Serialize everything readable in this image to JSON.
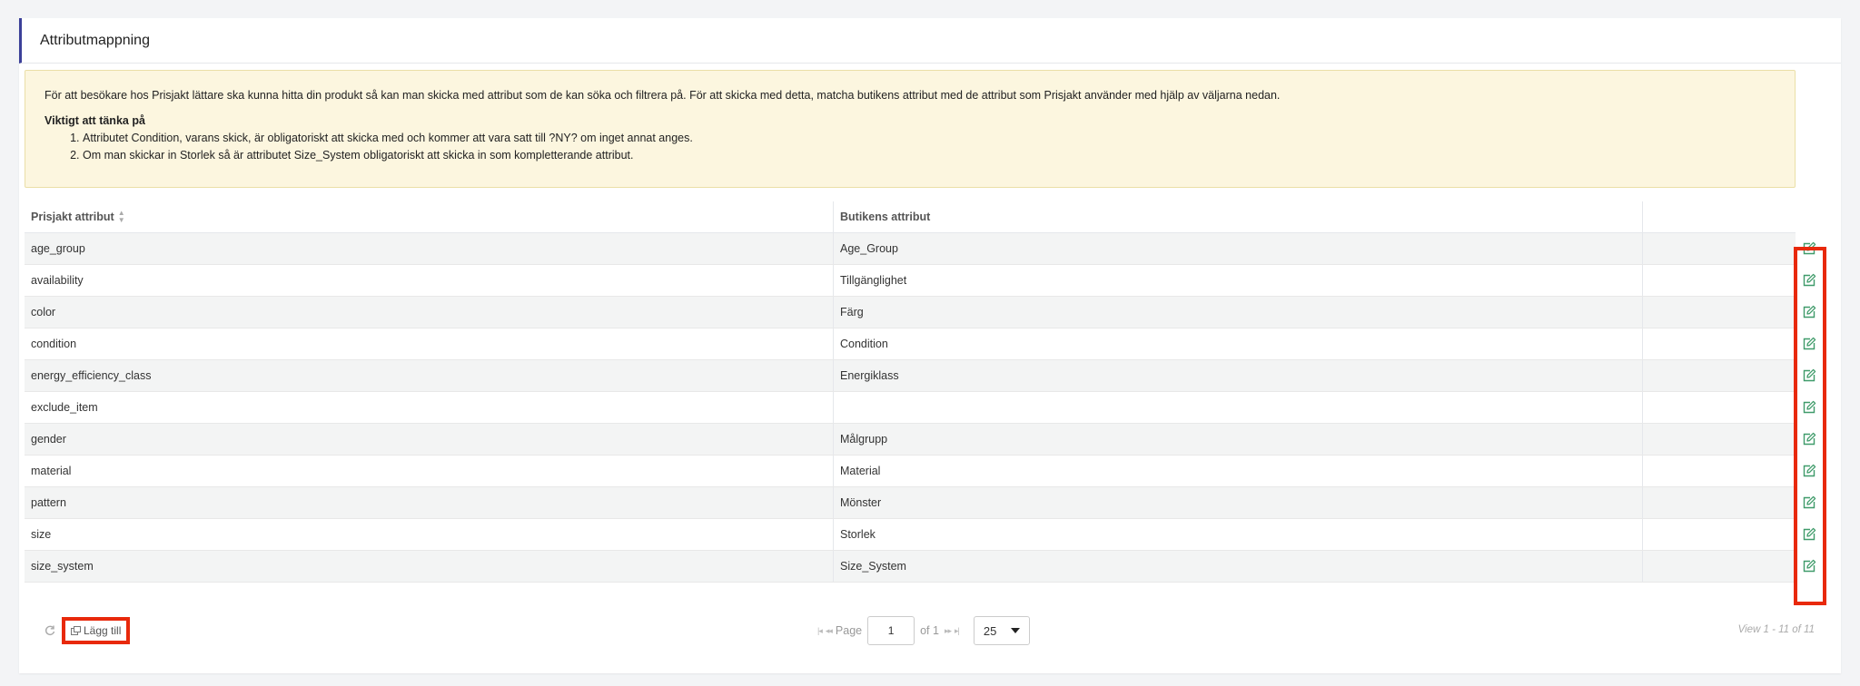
{
  "panel": {
    "title": "Attributmappning"
  },
  "notice": {
    "intro": "För att besökare hos Prisjakt lättare ska kunna hitta din produkt så kan man skicka med attribut som de kan söka och filtrera på. För att skicka med detta, matcha butikens attribut med de attribut som Prisjakt använder med hjälp av väljarna nedan.",
    "heading": "Viktigt att tänka på",
    "items": [
      "Attributet Condition, varans skick, är obligatoriskt att skicka med och kommer att vara satt till ?NY? om inget annat anges.",
      "Om man skickar in Storlek så är attributet Size_System obligatoriskt att skicka in som kompletterande attribut."
    ]
  },
  "grid": {
    "headers": {
      "prisjakt": "Prisjakt attribut",
      "butik": "Butikens attribut"
    },
    "rows": [
      {
        "prisjakt": "age_group",
        "butik": "Age_Group"
      },
      {
        "prisjakt": "availability",
        "butik": "Tillgänglighet"
      },
      {
        "prisjakt": "color",
        "butik": "Färg"
      },
      {
        "prisjakt": "condition",
        "butik": "Condition"
      },
      {
        "prisjakt": "energy_efficiency_class",
        "butik": "Energiklass"
      },
      {
        "prisjakt": "exclude_item",
        "butik": ""
      },
      {
        "prisjakt": "gender",
        "butik": "Målgrupp"
      },
      {
        "prisjakt": "material",
        "butik": "Material"
      },
      {
        "prisjakt": "pattern",
        "butik": "Mönster"
      },
      {
        "prisjakt": "size",
        "butik": "Storlek"
      },
      {
        "prisjakt": "size_system",
        "butik": "Size_System"
      }
    ]
  },
  "footer": {
    "add_label": "Lägg till",
    "page_label": "Page",
    "page_value": "1",
    "of_label": "of 1",
    "page_size": "25",
    "view_info": "View 1 - 11 of 11"
  },
  "colors": {
    "edit_icon": "#3f9b6a",
    "highlight": "#e8290b",
    "notice_bg": "#fcf6df",
    "header_accent": "#3b3f99"
  }
}
